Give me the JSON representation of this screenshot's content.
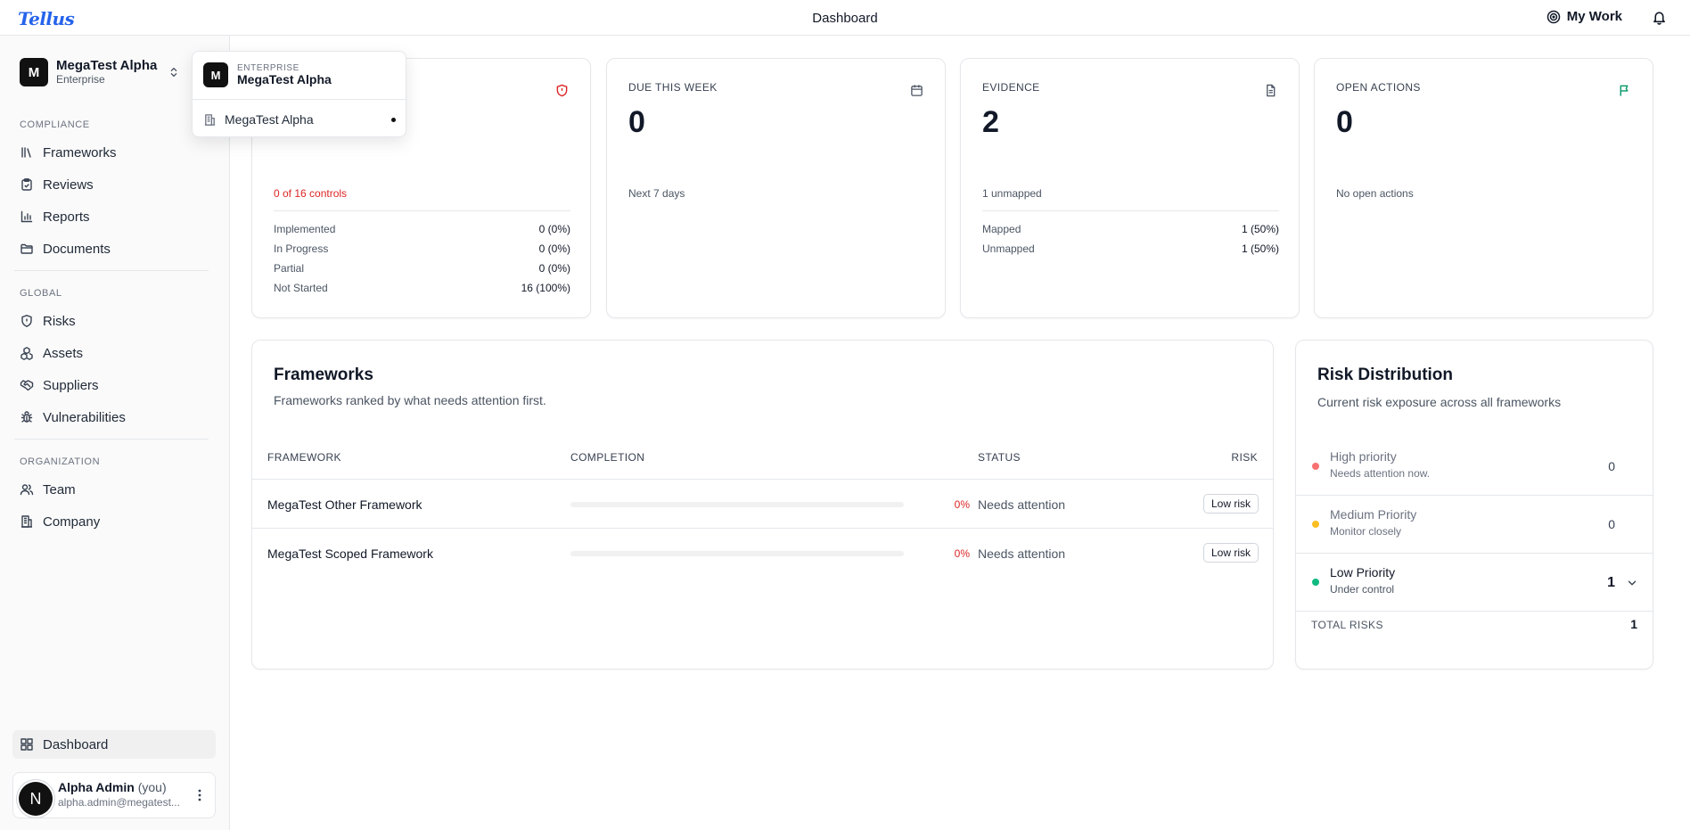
{
  "app": {
    "logo": "Tellus",
    "page_title": "Dashboard",
    "my_work_label": "My Work"
  },
  "colors": {
    "accent": "#2563eb",
    "danger": "#dc2626",
    "success": "#059669",
    "warning": "#fbbf24",
    "high": "#f87171"
  },
  "org_switcher": {
    "avatar": "M",
    "name": "MegaTest Alpha",
    "plan": "Enterprise"
  },
  "org_dropdown": {
    "avatar": "M",
    "eyebrow": "ENTERPRISE",
    "name": "MegaTest Alpha",
    "items": [
      {
        "label": "MegaTest Alpha",
        "selected": true
      }
    ]
  },
  "sidebar": {
    "sections": [
      {
        "title": "COMPLIANCE",
        "items": [
          {
            "label": "Frameworks",
            "icon": "library-icon"
          },
          {
            "label": "Reviews",
            "icon": "clipboard-check-icon"
          },
          {
            "label": "Reports",
            "icon": "bar-chart-icon"
          },
          {
            "label": "Documents",
            "icon": "folder-icon"
          }
        ]
      },
      {
        "title": "GLOBAL",
        "items": [
          {
            "label": "Risks",
            "icon": "shield-icon"
          },
          {
            "label": "Assets",
            "icon": "boxes-icon"
          },
          {
            "label": "Suppliers",
            "icon": "handshake-icon"
          },
          {
            "label": "Vulnerabilities",
            "icon": "bug-icon"
          }
        ]
      },
      {
        "title": "ORGANIZATION",
        "items": [
          {
            "label": "Team",
            "icon": "users-icon"
          },
          {
            "label": "Company",
            "icon": "building-icon"
          }
        ]
      }
    ],
    "dashboard_label": "Dashboard"
  },
  "user": {
    "avatar": "N",
    "name": "Alpha Admin",
    "you": "(you)",
    "email": "alpha.admin@megatest..."
  },
  "stats": {
    "controls": {
      "sub": "0 of 16 controls",
      "rows": [
        {
          "label": "Implemented",
          "value": "0 (0%)"
        },
        {
          "label": "In Progress",
          "value": "0 (0%)"
        },
        {
          "label": "Partial",
          "value": "0 (0%)"
        },
        {
          "label": "Not Started",
          "value": "16 (100%)"
        }
      ]
    },
    "due": {
      "label": "DUE THIS WEEK",
      "value": "0",
      "sub": "Next 7 days"
    },
    "evidence": {
      "label": "EVIDENCE",
      "value": "2",
      "sub": "1 unmapped",
      "rows": [
        {
          "label": "Mapped",
          "value": "1 (50%)"
        },
        {
          "label": "Unmapped",
          "value": "1 (50%)"
        }
      ]
    },
    "actions": {
      "label": "OPEN ACTIONS",
      "value": "0",
      "sub": "No open actions"
    }
  },
  "frameworks": {
    "title": "Frameworks",
    "subtitle": "Frameworks ranked by what needs attention first.",
    "columns": {
      "framework": "FRAMEWORK",
      "completion": "COMPLETION",
      "status": "STATUS",
      "risk": "RISK"
    },
    "rows": [
      {
        "name": "MegaTest Other Framework",
        "completion": 0,
        "completion_label": "0%",
        "status": "Needs attention",
        "risk": "Low risk"
      },
      {
        "name": "MegaTest Scoped Framework",
        "completion": 0,
        "completion_label": "0%",
        "status": "Needs attention",
        "risk": "Low risk"
      }
    ]
  },
  "risk_distribution": {
    "title": "Risk Distribution",
    "subtitle": "Current risk exposure across all frameworks",
    "rows": [
      {
        "name": "High priority",
        "desc": "Needs attention now.",
        "count": "0",
        "color": "#f87171"
      },
      {
        "name": "Medium Priority",
        "desc": "Monitor closely",
        "count": "0",
        "color": "#fbbf24"
      },
      {
        "name": "Low Priority",
        "desc": "Under control",
        "count": "1",
        "color": "#10b981"
      }
    ],
    "total_label": "TOTAL RISKS",
    "total": "1"
  }
}
